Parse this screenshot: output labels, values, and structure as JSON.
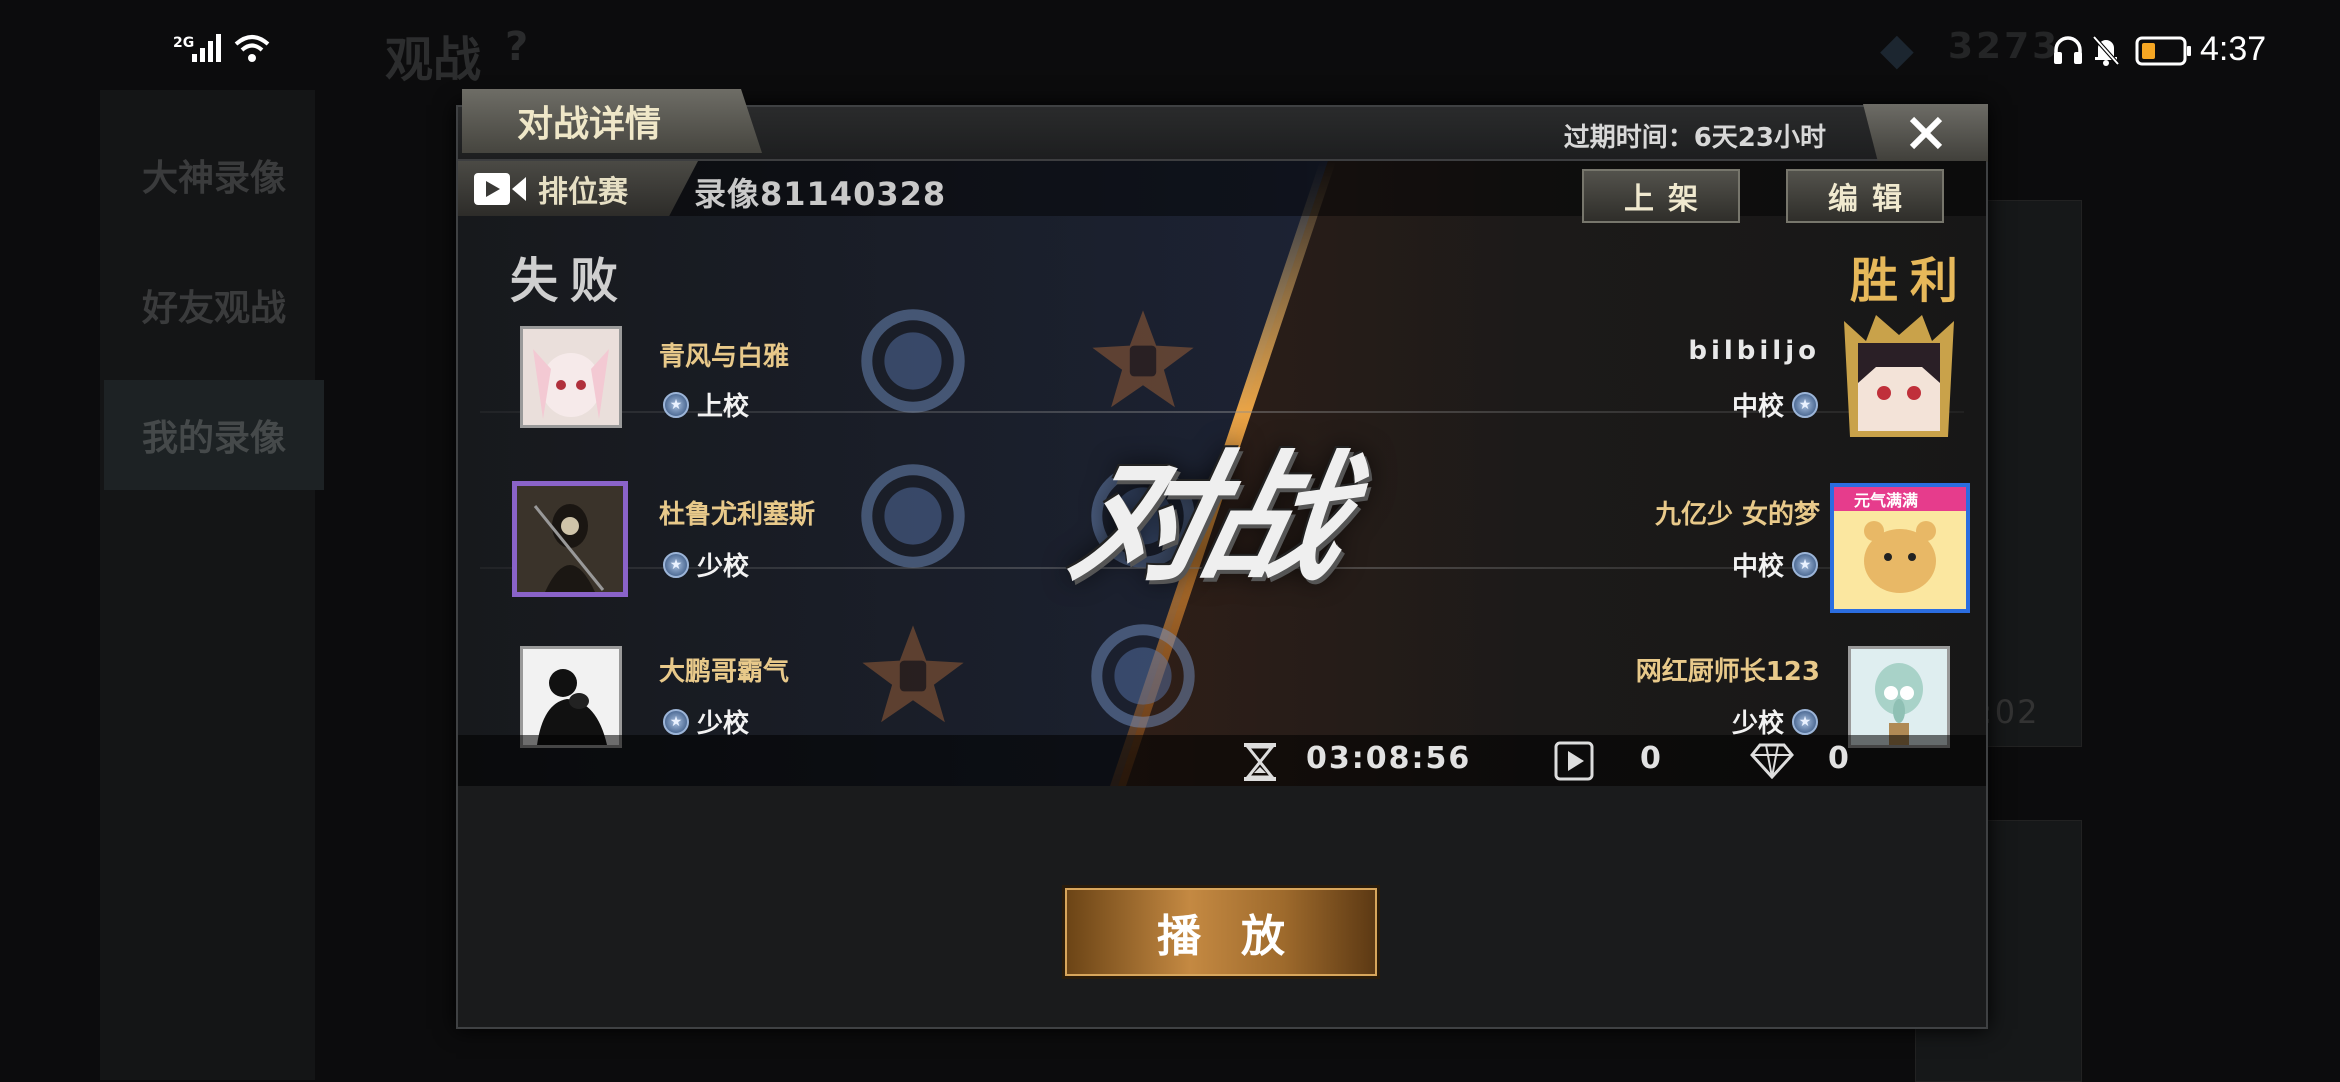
{
  "status_bar": {
    "network": "2G",
    "time": "4:37",
    "icons": [
      "signal-icon",
      "wifi-icon",
      "headphone-icon",
      "bell-muted-icon",
      "battery-icon"
    ],
    "battery_color": "#f5a623"
  },
  "background": {
    "title": "观战",
    "help_mark": "?",
    "side_menu": [
      "大神录像",
      "好友观战",
      "我的录像"
    ],
    "diamond_count": "3273",
    "card_time": ":02"
  },
  "dialog": {
    "title": "对战详情",
    "expiry": "过期时间：6天23小时",
    "close_label": "X",
    "match_type": "排位赛",
    "replay_id": "录像81140328",
    "list_button": "上架",
    "edit_button": "编辑",
    "lose_label": "失败",
    "win_label": "胜利",
    "vs_text": "对战",
    "losers": [
      {
        "name": "青风与白雅",
        "rank": "上校"
      },
      {
        "name": "杜鲁尤利塞斯",
        "rank": "少校"
      },
      {
        "name": "大鹏哥霸气",
        "rank": "少校"
      }
    ],
    "winners": [
      {
        "name": "bilbiljo",
        "rank": "中校"
      },
      {
        "name": "九亿少 女的梦",
        "rank": "中校"
      },
      {
        "name": "网红厨师长123",
        "rank": "少校"
      }
    ],
    "avatar_badge": "元气满满",
    "duration": "03:08:56",
    "play_count": "0",
    "diamond_count": "0",
    "play_button": "播放"
  },
  "colors": {
    "gold_text": "#e8c98a",
    "win_gold": "#e6b85a",
    "blue_side": "#253e8a",
    "orange_side": "#672c15",
    "play_button": "#c48942"
  }
}
